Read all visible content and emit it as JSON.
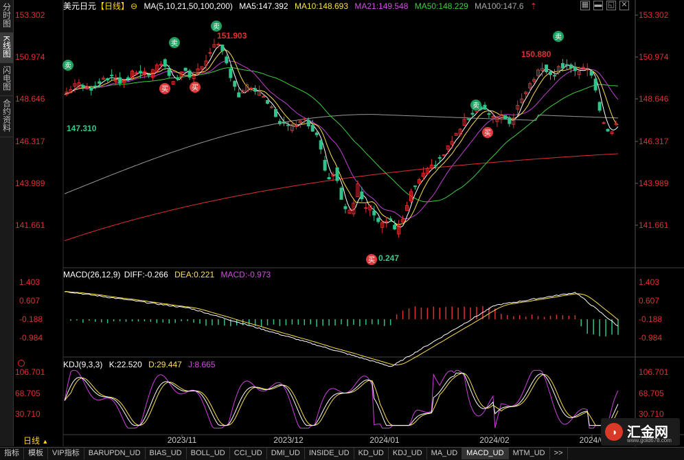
{
  "header": {
    "symbol": "美元日元",
    "period_tag": "【日线】",
    "ma_label": "MA(5,10,21,50,100,200)",
    "ma5": "MA5:147.392",
    "ma10": "MA10:148.693",
    "ma21": "MA21:149.548",
    "ma50": "MA50:148.229",
    "ma100": "MA100:147.6"
  },
  "sidebar": {
    "tabs": [
      {
        "label": "分时图",
        "active": false
      },
      {
        "label": "K线图",
        "active": true
      },
      {
        "label": "闪电图",
        "active": false
      },
      {
        "label": "合约资料",
        "active": false
      }
    ]
  },
  "price_axis": {
    "labels": [
      "153.302",
      "150.974",
      "148.646",
      "146.317",
      "143.989",
      "141.661"
    ],
    "color": "#e04848"
  },
  "annotations": {
    "high_label": "151.903",
    "low_label": "147.310",
    "recent_high": "150.880",
    "low2_label": "0.247",
    "sell": "卖",
    "buy": "买"
  },
  "macd": {
    "label": "MACD(26,12,9)",
    "diff": "DIFF:-0.266",
    "dea": "DEA:0.221",
    "macd": "MACD:-0.973",
    "axis": [
      "1.403",
      "0.607",
      "-0.188",
      "-0.984"
    ]
  },
  "kdj": {
    "label": "KDJ(9,3,3)",
    "k": "K:22.520",
    "d": "D:29.447",
    "j": "J:8.665",
    "axis": [
      "106.701",
      "68.705",
      "30.710"
    ]
  },
  "time_axis": [
    "2023/11",
    "2023/12",
    "2024/01",
    "2024/02",
    "2024/0"
  ],
  "period_selector": "日线",
  "bottom_tabs": [
    "指标",
    "模板",
    "VIP指标",
    "BARUPDN_UD",
    "BIAS_UD",
    "BOLL_UD",
    "CCI_UD",
    "DMI_UD",
    "INSIDE_UD",
    "KD_UD",
    "KDJ_UD",
    "MA_UD",
    "MACD_UD",
    "MTM_UD",
    ">>"
  ],
  "active_bottom_tab": "MACD_UD",
  "logo": {
    "text": "汇金网",
    "url": "www.gold678.com"
  },
  "colors": {
    "up": "#e03030",
    "down": "#2fc48a",
    "ma5": "#ffffff",
    "ma10": "#ffe04a",
    "ma21": "#c040d0",
    "ma50": "#3cd040",
    "ma100": "#9a9a9a",
    "ma200": "#e03030"
  }
}
